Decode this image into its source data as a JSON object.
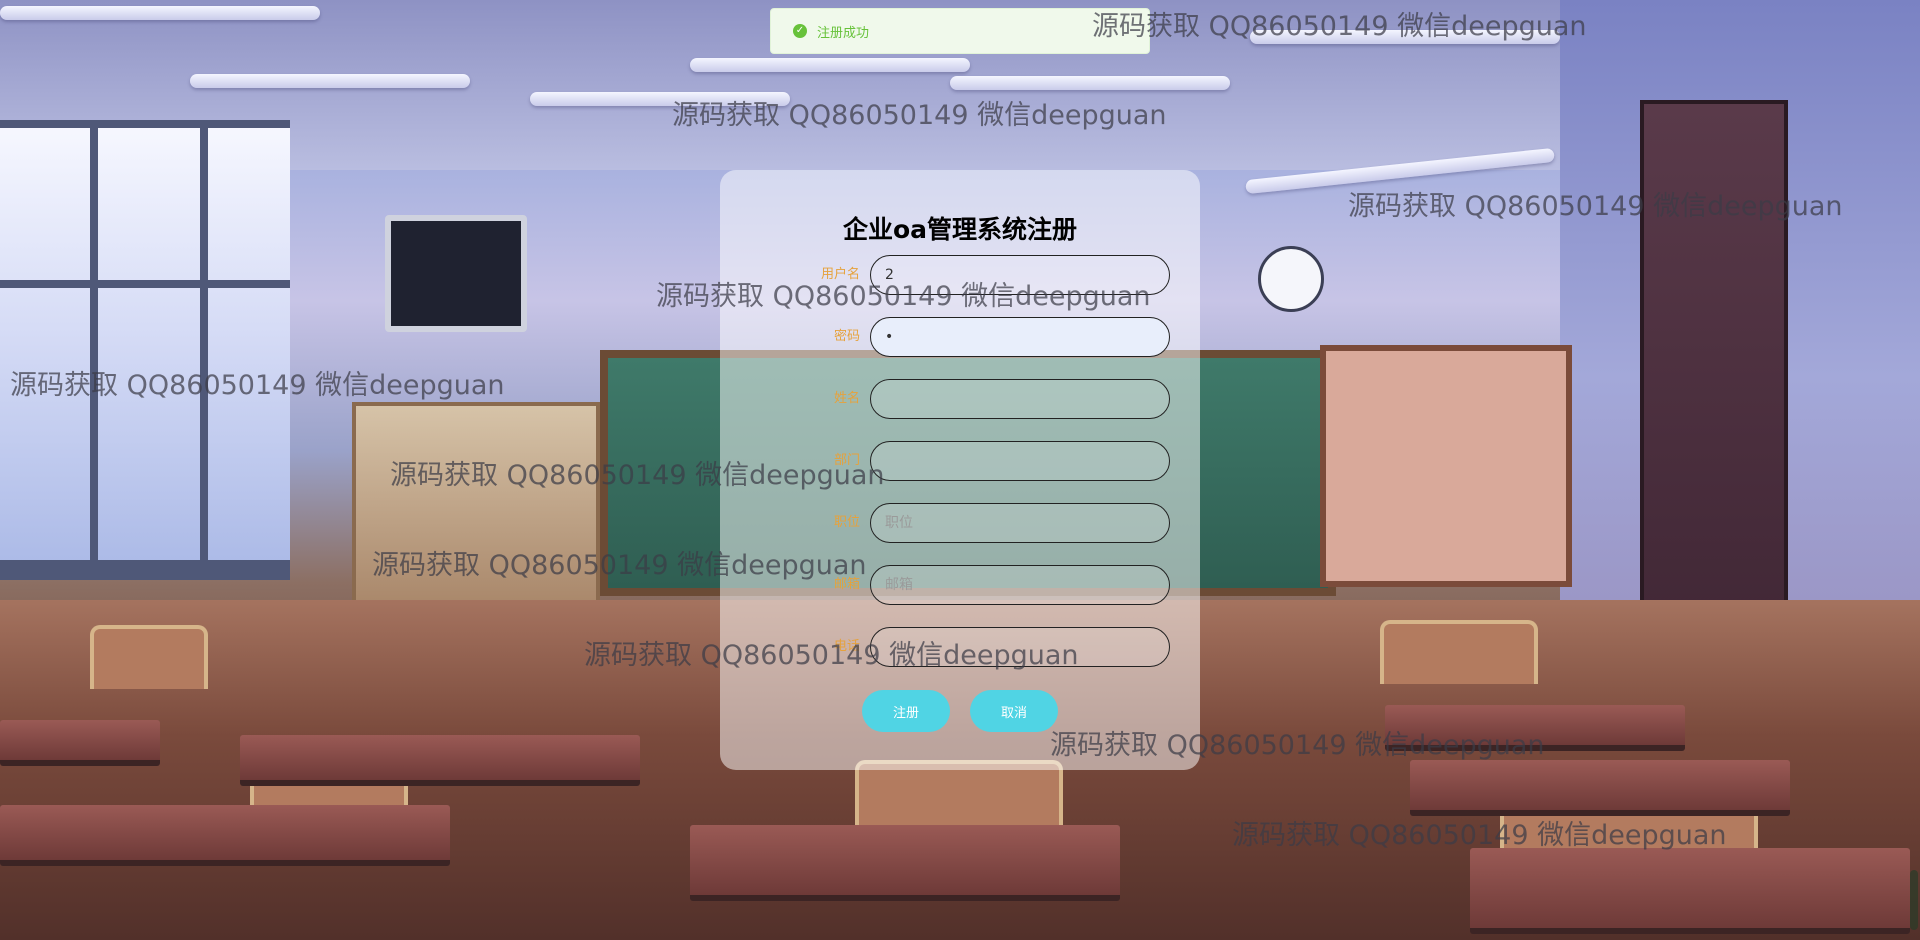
{
  "toast": {
    "icon": "check-icon",
    "message": "注册成功",
    "color": "#67c23a"
  },
  "form": {
    "title": "企业oa管理系统注册",
    "fields": [
      {
        "label": "用户名",
        "value": "2",
        "placeholder": ""
      },
      {
        "label": "密码",
        "value": "•",
        "placeholder": ""
      },
      {
        "label": "姓名",
        "value": "",
        "placeholder": ""
      },
      {
        "label": "部门",
        "value": "",
        "placeholder": ""
      },
      {
        "label": "职位",
        "value": "",
        "placeholder": "职位"
      },
      {
        "label": "邮箱",
        "value": "",
        "placeholder": "邮箱"
      },
      {
        "label": "电话",
        "value": "",
        "placeholder": ""
      }
    ],
    "register_label": "注册",
    "cancel_label": "取消",
    "label_color": "#e6a23c",
    "button_color": "#50d4e4"
  },
  "watermark": {
    "text": "源码获取 QQ86050149 微信deepguan"
  }
}
